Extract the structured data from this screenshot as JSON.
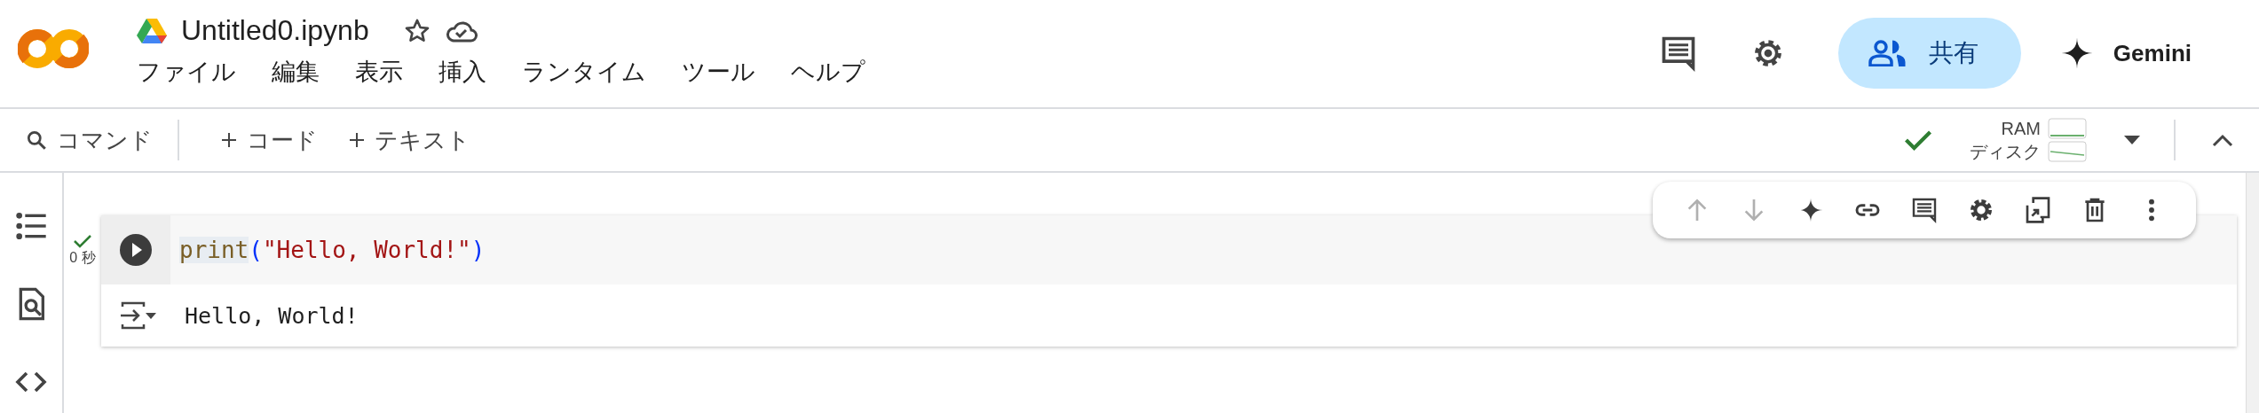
{
  "header": {
    "title": "Untitled0.ipynb",
    "starred": false,
    "menu": [
      "ファイル",
      "編集",
      "表示",
      "挿入",
      "ランタイム",
      "ツール",
      "ヘルプ"
    ],
    "share_label": "共有",
    "gemini_label": "Gemini"
  },
  "toolbar": {
    "command_label": "コマンド",
    "add_buttons": [
      "コード",
      "テキスト"
    ],
    "connected": true,
    "ram_label": "RAM",
    "disk_label": "ディスク"
  },
  "sidebar": {
    "items": [
      {
        "kind": "toc"
      },
      {
        "kind": "find"
      },
      {
        "kind": "code"
      }
    ]
  },
  "cell": {
    "status": {
      "success": true,
      "time": "0 秒"
    },
    "code": [
      {
        "kind": "function",
        "text": "print"
      },
      {
        "kind": "paren",
        "text": "("
      },
      {
        "kind": "string",
        "text": "\"Hello, World!\""
      },
      {
        "kind": "paren",
        "text": ")"
      }
    ],
    "output": "Hello, World!",
    "toolbar": [
      {
        "kind": "up",
        "disabled": true
      },
      {
        "kind": "down",
        "disabled": true
      },
      {
        "kind": "sparkle",
        "disabled": false
      },
      {
        "kind": "link",
        "disabled": false
      },
      {
        "kind": "comment",
        "disabled": false
      },
      {
        "kind": "gear",
        "disabled": false
      },
      {
        "kind": "mirror",
        "disabled": false
      },
      {
        "kind": "trash",
        "disabled": false
      },
      {
        "kind": "more",
        "disabled": false
      }
    ]
  }
}
